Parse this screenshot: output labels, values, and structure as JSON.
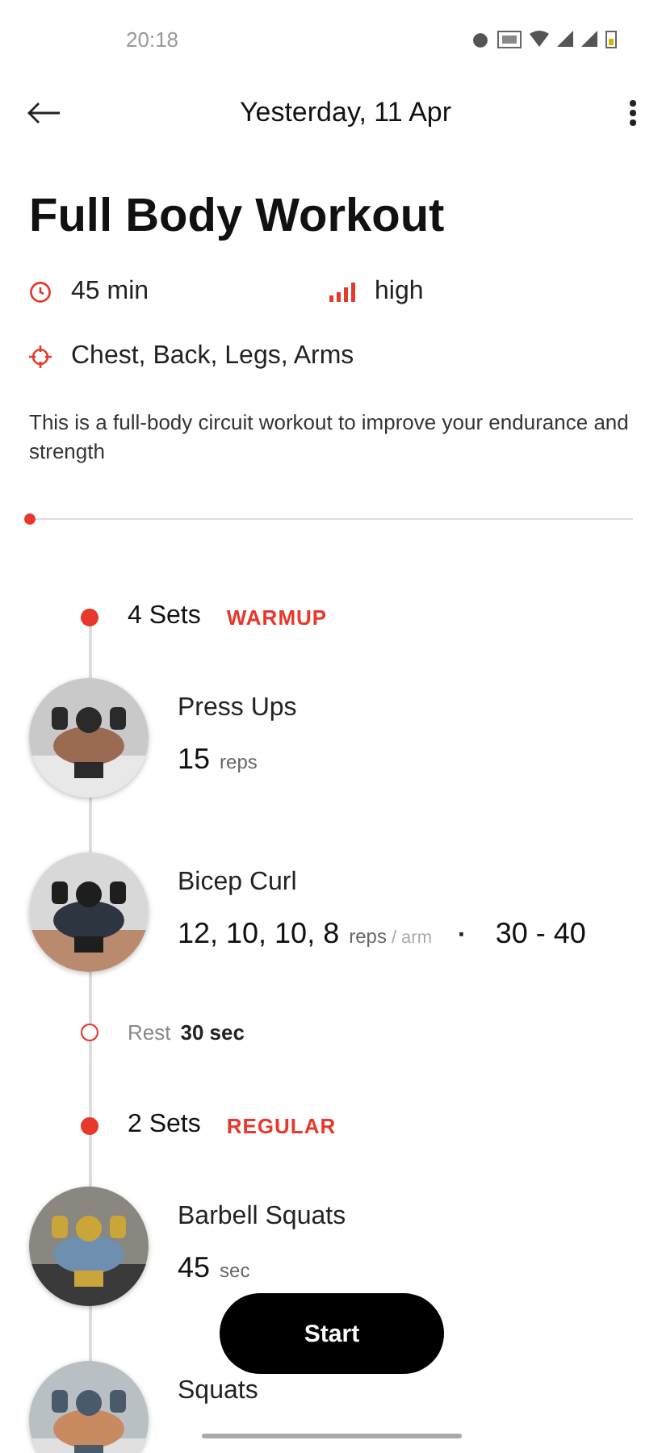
{
  "status_bar": {
    "time": "20:18"
  },
  "header": {
    "title": "Yesterday, 11 Apr"
  },
  "workout": {
    "title": "Full Body Workout",
    "duration": "45 min",
    "intensity": "high",
    "muscles": "Chest, Back, Legs, Arms",
    "description": "This is a full-body circuit workout to improve your endurance and strength"
  },
  "progress": {
    "level": 0
  },
  "groups": [
    {
      "sets": "4 Sets",
      "tag": "WARMUP",
      "items": [
        {
          "kind": "exercise",
          "name": "Press Ups",
          "amount": "15",
          "unit": "reps"
        },
        {
          "kind": "exercise",
          "name": "Bicep Curl",
          "amount": "12, 10, 10, 8",
          "unit": "reps",
          "unit_suffix": "/ arm",
          "separator": "·",
          "extra": "30 - 40"
        },
        {
          "kind": "rest",
          "label": "Rest",
          "amount": "30 sec"
        }
      ]
    },
    {
      "sets": "2 Sets",
      "tag": "REGULAR",
      "items": [
        {
          "kind": "exercise",
          "name": "Barbell Squats",
          "amount": "45",
          "unit": "sec"
        },
        {
          "kind": "exercise",
          "name": "Squats"
        }
      ]
    }
  ],
  "start_button": {
    "label": "Start"
  }
}
